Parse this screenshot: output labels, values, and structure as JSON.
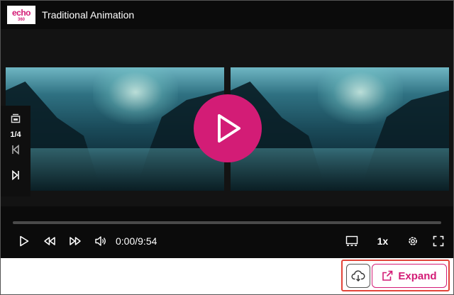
{
  "header": {
    "logo_brand": "echo",
    "logo_number": "360",
    "title": "Traditional Animation"
  },
  "side_panel": {
    "source_count": "1/4",
    "icons": [
      "layout-icon",
      "previous-source-icon",
      "next-source-icon"
    ]
  },
  "player": {
    "progress_fraction": 0,
    "time_display": "0:00/9:54",
    "speed": "1x",
    "big_play_icon": "play-icon"
  },
  "controls": {
    "icons": [
      "play-icon",
      "rewind-icon",
      "fast-forward-icon",
      "volume-icon",
      "display-layout-icon",
      "settings-icon",
      "fullscreen-icon"
    ]
  },
  "actions": {
    "expand_label": "Expand",
    "download_icon": "cloud-download-icon",
    "expand_icon": "external-link-icon"
  },
  "colors": {
    "accent": "#d31c76",
    "player_bg": "#0b0b0b",
    "highlight_outline": "#e2443a"
  }
}
